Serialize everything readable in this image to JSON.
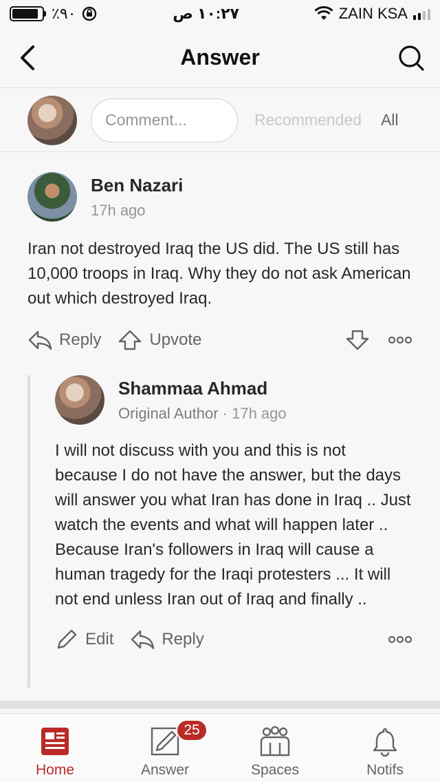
{
  "status_bar": {
    "battery": "٪٩٠",
    "time": "١٠:٢٧ ص",
    "carrier": "ZAIN KSA"
  },
  "header": {
    "title": "Answer",
    "back_icon": "chevron-left-icon",
    "search_icon": "search-icon"
  },
  "comment_bar": {
    "placeholder": "Comment...",
    "filter_recommended": "Recommended",
    "filter_all": "All"
  },
  "comment": {
    "author": "Ben Nazari",
    "time": "17h ago",
    "body": "Iran not destroyed Iraq the US did. The US still has 10,000 troops in Iraq. Why they do not ask American out which destroyed Iraq.",
    "reply_label": "Reply",
    "upvote_label": "Upvote"
  },
  "reply": {
    "author": "Shammaa Ahmad",
    "role": "Original Author",
    "separator": " · ",
    "time": "17h ago",
    "body": "I will not discuss with you and this is not because I do not have the answer, but the days will answer you what Iran has done in Iraq .. Just watch the events and what will happen later .. Because Iran's followers in Iraq will cause a human tragedy for the Iraqi protesters ... It will not end unless Iran out of Iraq and finally ..",
    "edit_label": "Edit",
    "reply_label": "Reply"
  },
  "tab_bar": {
    "home": "Home",
    "answer": "Answer",
    "answer_badge": "25",
    "spaces": "Spaces",
    "notifs": "Notifs"
  },
  "colors": {
    "accent": "#b92b27",
    "text": "#282829",
    "muted": "#939598"
  }
}
